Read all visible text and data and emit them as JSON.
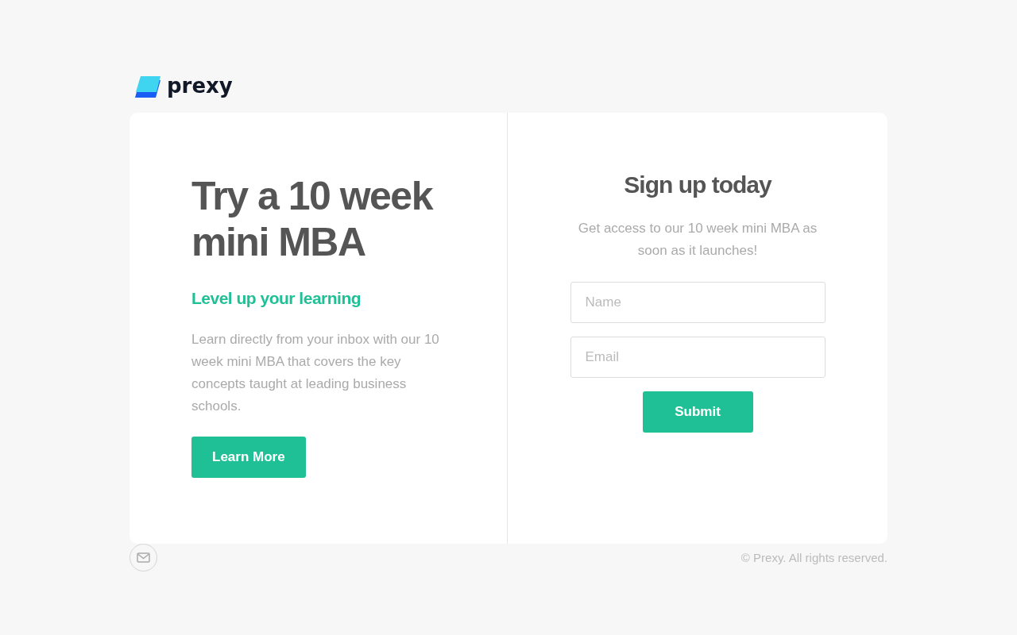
{
  "brand": {
    "name": "prexy"
  },
  "hero": {
    "title": "Try a 10 week mini MBA",
    "subtitle": "Level up your learning",
    "body": "Learn directly from your inbox with our 10 week mini MBA that covers the key concepts taught at leading business schools.",
    "button": "Learn More"
  },
  "signup": {
    "title": "Sign up today",
    "intro": "Get access to our 10 week mini MBA as soon as it launches!",
    "fields": [
      {
        "placeholder": "Name"
      },
      {
        "placeholder": "Email"
      }
    ],
    "button": "Submit"
  },
  "footer": {
    "copyright": "© Prexy. All rights reserved."
  }
}
